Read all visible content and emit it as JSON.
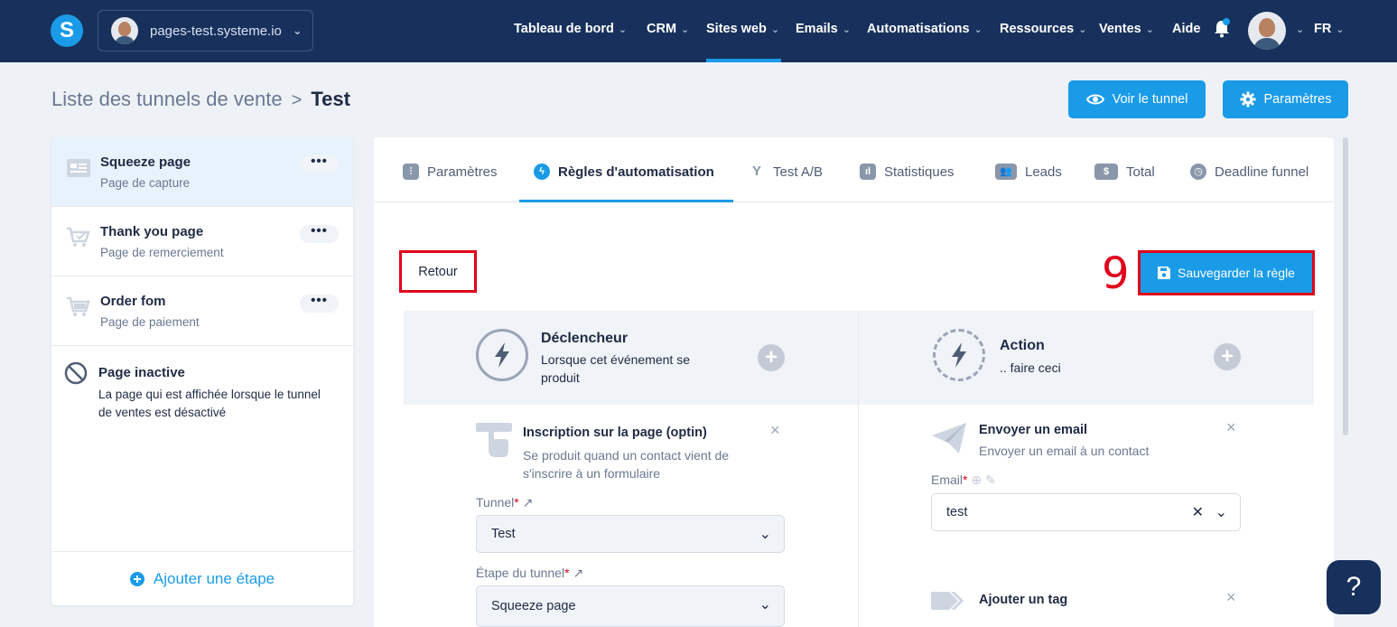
{
  "topbar": {
    "site_name": "pages-test.systeme.io",
    "nav": [
      {
        "label": "Tableau de bord"
      },
      {
        "label": "CRM"
      },
      {
        "label": "Sites web"
      },
      {
        "label": "Emails"
      },
      {
        "label": "Automatisations"
      },
      {
        "label": "Ressources"
      },
      {
        "label": "Ventes"
      },
      {
        "label": "Aide"
      }
    ],
    "language": "FR",
    "logo_letter": "S"
  },
  "header": {
    "breadcrumb_parent": "Liste des tunnels de vente",
    "breadcrumb_separator": ">",
    "breadcrumb_current": "Test",
    "view_button": "Voir le tunnel",
    "settings_button": "Paramètres"
  },
  "steps": [
    {
      "title": "Squeeze page",
      "subtitle": "Page de capture",
      "menu": "•••"
    },
    {
      "title": "Thank you page",
      "subtitle": "Page de remerciement",
      "menu": "•••"
    },
    {
      "title": "Order fom",
      "subtitle": "Page de paiement",
      "menu": "•••"
    }
  ],
  "inactive_page": {
    "title": "Page inactive",
    "description": "La page qui est affichée lorsque le tunnel de ventes est désactivé"
  },
  "add_step": "Ajouter une étape",
  "tabs": [
    {
      "label": "Paramètres"
    },
    {
      "label": "Règles d'automatisation"
    },
    {
      "label": "Test A/B"
    },
    {
      "label": "Statistiques"
    },
    {
      "label": "Leads"
    },
    {
      "label": "Total"
    },
    {
      "label": "Deadline funnel"
    }
  ],
  "rule": {
    "back": "Retour",
    "step_number": "9",
    "save": "Sauvegarder la règle",
    "trigger": {
      "title": "Déclencheur",
      "subtitle": "Lorsque cet événement se produit",
      "card_title": "Inscription sur la page (optin)",
      "card_desc": "Se produit quand un contact vient de s'inscrire à un formulaire",
      "tunnel_label": "Tunnel",
      "tunnel_value": "Test",
      "step_label": "Étape du tunnel",
      "step_value": "Squeeze page"
    },
    "action": {
      "title": "Action",
      "subtitle": ".. faire ceci",
      "card_title": "Envoyer un email",
      "card_desc": "Envoyer un email à un contact",
      "email_label": "Email",
      "email_value": "test",
      "card2_title": "Ajouter un tag"
    }
  },
  "help": "?"
}
